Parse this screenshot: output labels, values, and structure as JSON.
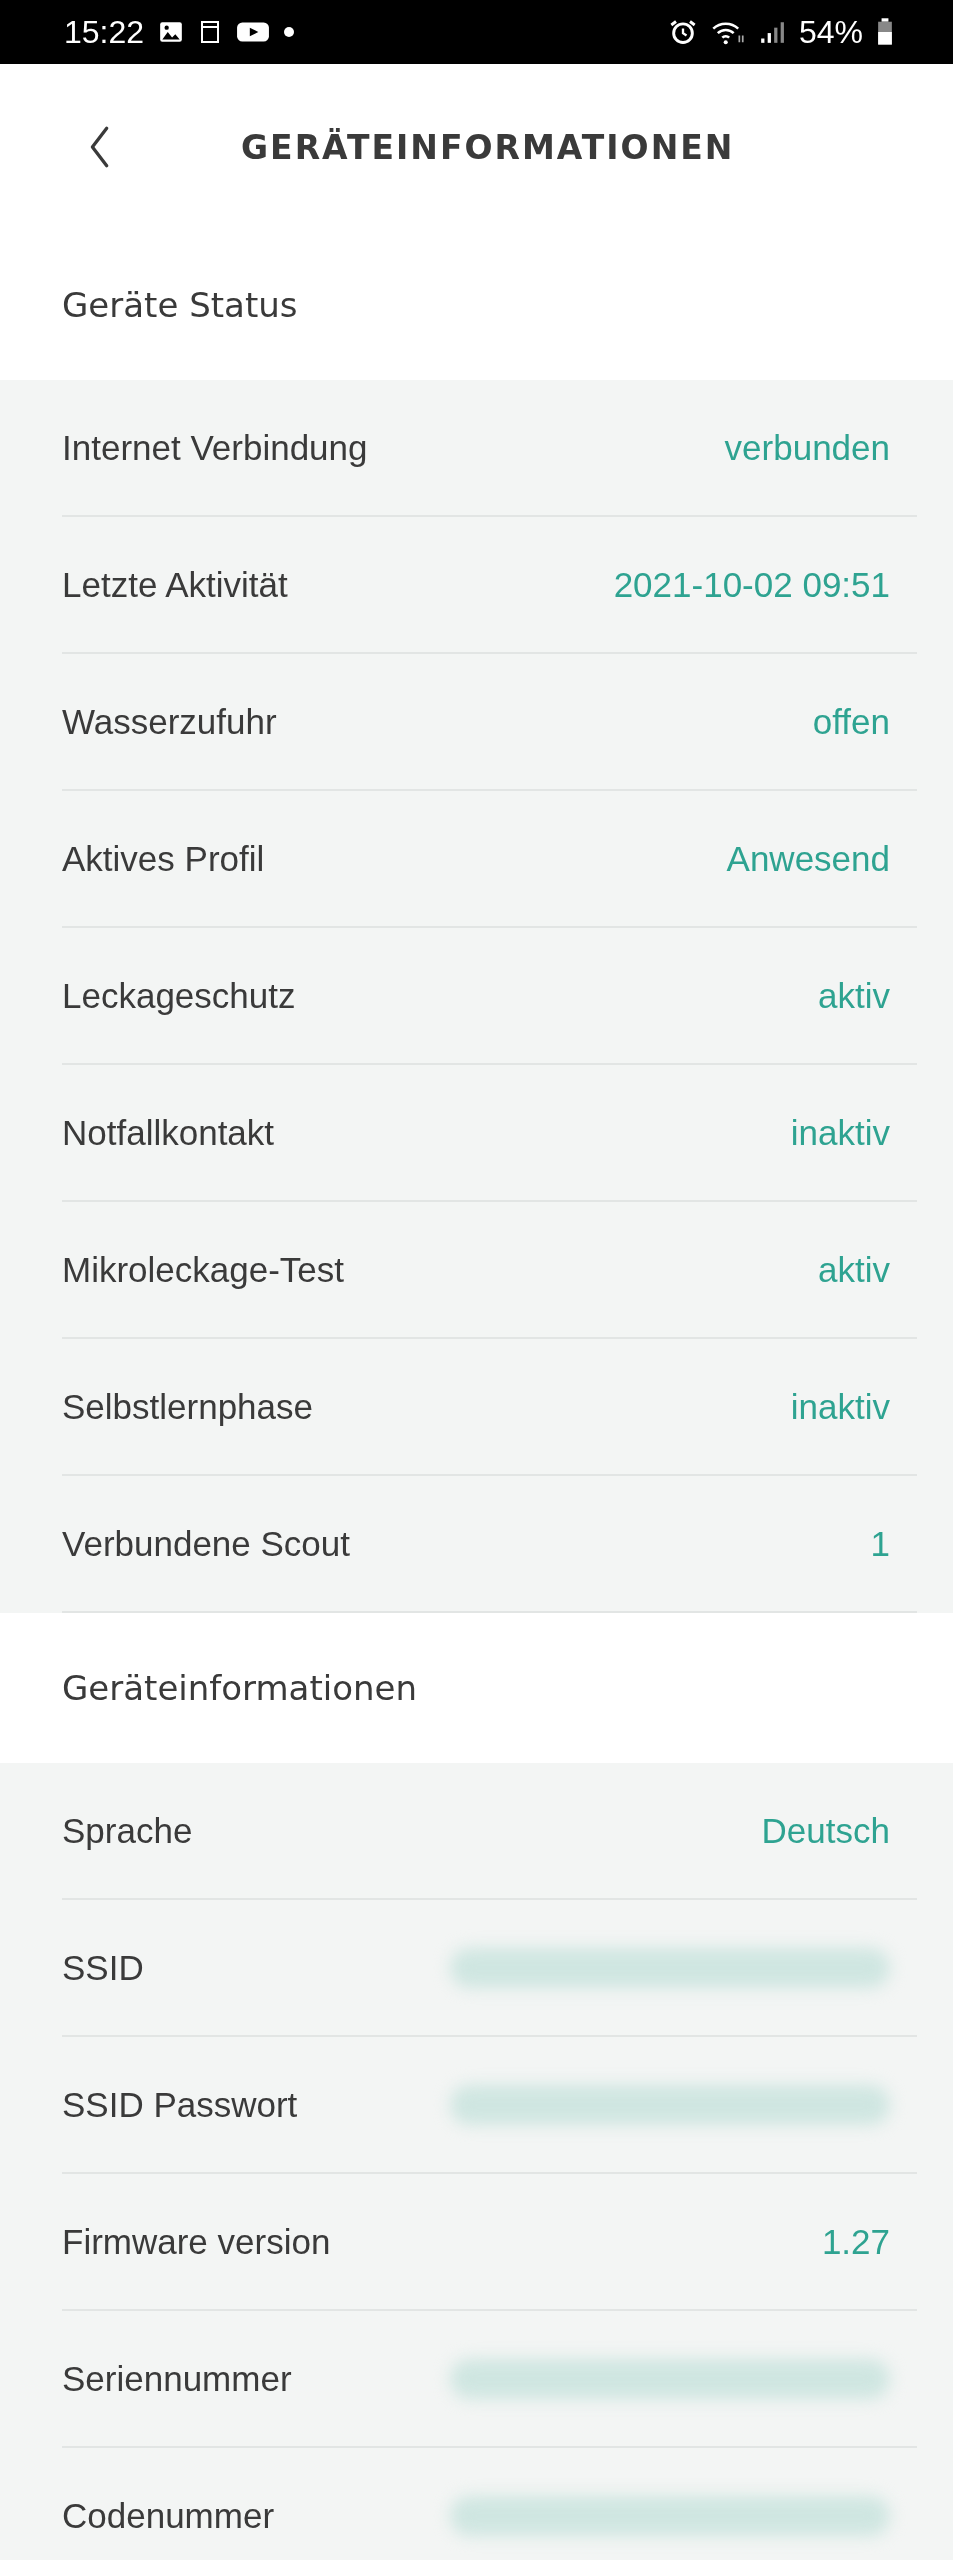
{
  "status_bar": {
    "time": "15:22",
    "battery": "54%"
  },
  "header": {
    "title": "GERÄTEINFORMATIONEN"
  },
  "sections": [
    {
      "title": "Geräte Status",
      "rows": [
        {
          "label": "Internet Verbindung",
          "value": "verbunden"
        },
        {
          "label": "Letzte Aktivität",
          "value": "2021-10-02 09:51"
        },
        {
          "label": "Wasserzufuhr",
          "value": "offen"
        },
        {
          "label": "Aktives Profil",
          "value": "Anwesend"
        },
        {
          "label": "Leckageschutz",
          "value": "aktiv"
        },
        {
          "label": "Notfallkontakt",
          "value": "inaktiv"
        },
        {
          "label": "Mikroleckage-Test",
          "value": "aktiv"
        },
        {
          "label": "Selbstlernphase",
          "value": "inaktiv"
        },
        {
          "label": "Verbundene Scout",
          "value": "1"
        }
      ]
    },
    {
      "title": "Geräteinformationen",
      "rows": [
        {
          "label": "Sprache",
          "value": "Deutsch"
        },
        {
          "label": "SSID",
          "redacted": true
        },
        {
          "label": "SSID Passwort",
          "redacted": true
        },
        {
          "label": "Firmware version",
          "value": "1.27"
        },
        {
          "label": "Seriennummer",
          "redacted": true
        },
        {
          "label": "Codenummer",
          "redacted": true
        }
      ]
    }
  ]
}
